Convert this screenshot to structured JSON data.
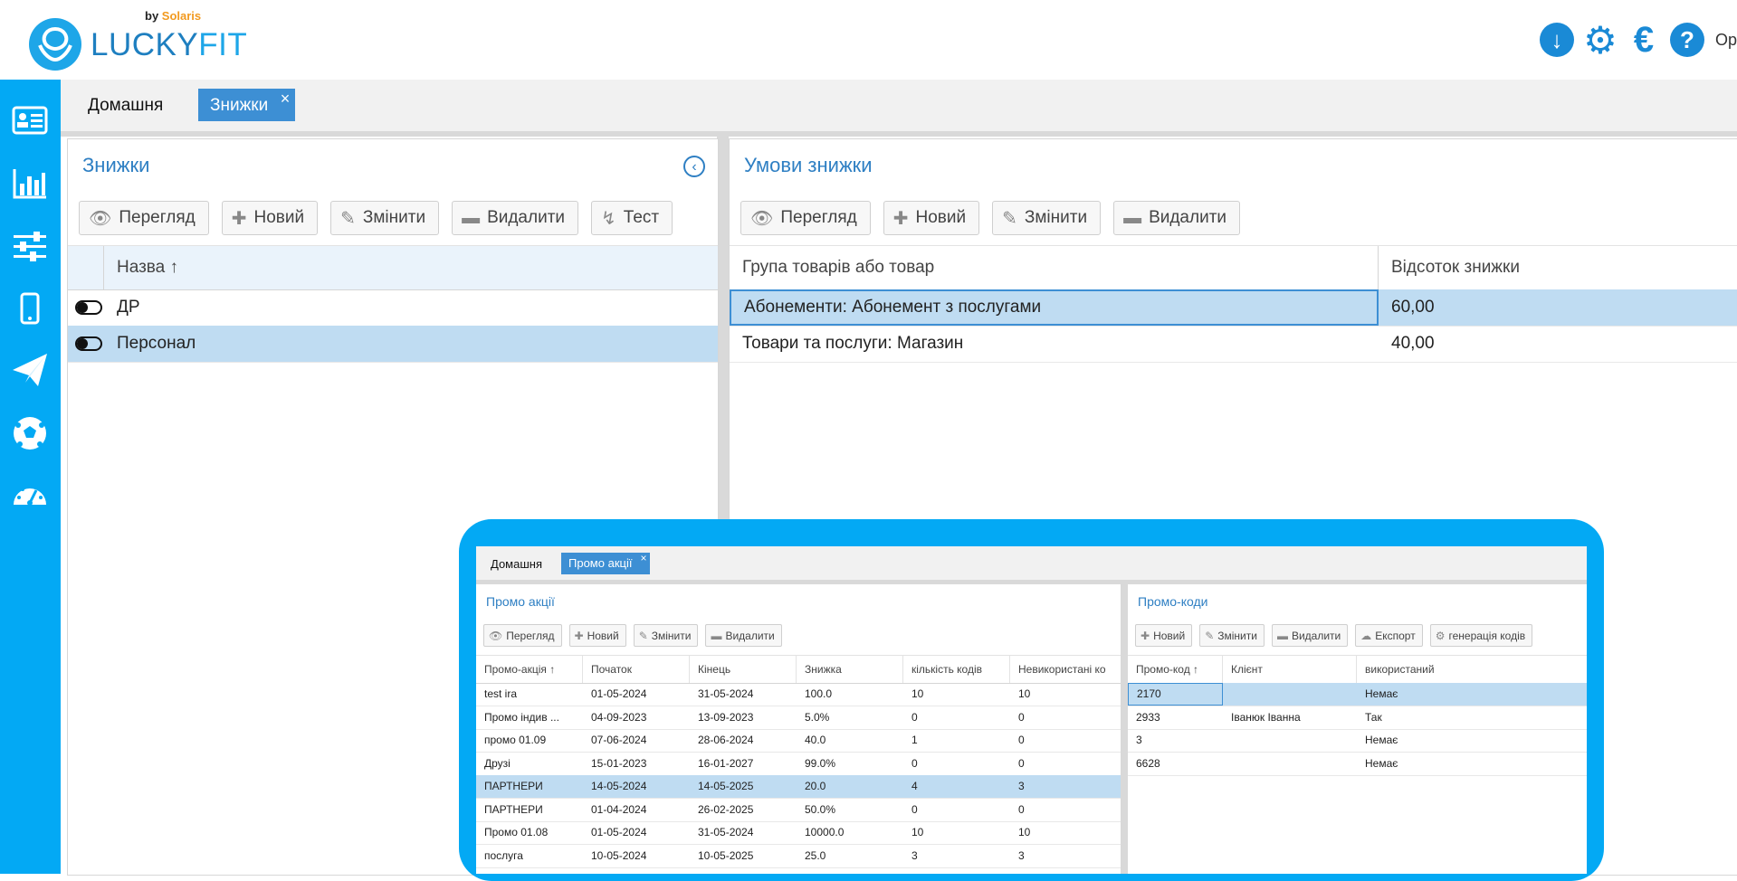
{
  "header": {
    "logo_by": "by",
    "logo_brand": "Solaris",
    "logo_lucky": "LUCKY",
    "logo_fit": "FIT",
    "user_text": "Op"
  },
  "colors": {
    "accent": "#03a9f4",
    "primary": "#3d8fd4",
    "selected_row": "#bfdcf2",
    "title": "#2e7fc3"
  },
  "sidebar": {
    "items": [
      {
        "icon": "contact-card-icon"
      },
      {
        "icon": "bar-chart-icon"
      },
      {
        "icon": "sliders-icon"
      },
      {
        "icon": "mobile-phone-icon"
      },
      {
        "icon": "paper-plane-icon"
      },
      {
        "icon": "soccer-ball-icon"
      },
      {
        "icon": "dashboard-gauge-icon"
      }
    ]
  },
  "tabs": {
    "home": "Домашня",
    "active": "Знижки",
    "close": "×"
  },
  "left_panel": {
    "title": "Знижки",
    "buttons": {
      "view": "Перегляд",
      "new": "Новий",
      "edit": "Змінити",
      "delete": "Видалити",
      "test": "Тест"
    },
    "column": "Назва ↑",
    "rows": [
      {
        "name": "ДР",
        "selected": false
      },
      {
        "name": "Персонал",
        "selected": true
      }
    ]
  },
  "right_panel": {
    "title": "Умови знижки",
    "buttons": {
      "view": "Перегляд",
      "new": "Новий",
      "edit": "Змінити",
      "delete": "Видалити"
    },
    "columns": [
      "Група товарів або товар",
      "Відсоток знижки"
    ],
    "rows": [
      [
        "Абонементи: Абонемент з послугами",
        "60,00"
      ],
      [
        "Товари та послуги: Магазин",
        "40,00"
      ]
    ]
  },
  "inset": {
    "tabs": {
      "home": "Домашня",
      "active": "Промо акції",
      "close": "×"
    },
    "promo": {
      "title": "Промо акції",
      "buttons": {
        "view": "Перегляд",
        "new": "Новий",
        "edit": "Змінити",
        "delete": "Видалити"
      },
      "columns": [
        "Промо-акція ↑",
        "Початок",
        "Кінець",
        "Знижка",
        "кількість кодів",
        "Невикористані ко"
      ],
      "rows": [
        [
          "test ira",
          "01-05-2024",
          "31-05-2024",
          "100.0",
          "10",
          "10"
        ],
        [
          "Промо індив ...",
          "04-09-2023",
          "13-09-2023",
          "5.0%",
          "0",
          "0"
        ],
        [
          "промо 01.09",
          "07-06-2024",
          "28-06-2024",
          "40.0",
          "1",
          "0"
        ],
        [
          "Друзі",
          "15-01-2023",
          "16-01-2027",
          "99.0%",
          "0",
          "0"
        ],
        [
          "ПАРТНЕРИ",
          "14-05-2024",
          "14-05-2025",
          "20.0",
          "4",
          "3"
        ],
        [
          "ПАРТНЕРИ",
          "01-04-2024",
          "26-02-2025",
          "50.0%",
          "0",
          "0"
        ],
        [
          "Промо 01.08",
          "01-05-2024",
          "31-05-2024",
          "10000.0",
          "10",
          "10"
        ],
        [
          "послуга",
          "10-05-2024",
          "10-05-2025",
          "25.0",
          "3",
          "3"
        ]
      ],
      "selected_index": 4
    },
    "codes": {
      "title": "Промо-коди",
      "buttons": {
        "new": "Новий",
        "edit": "Змінити",
        "delete": "Видалити",
        "export": "Експорт",
        "generate": "генерація кодів"
      },
      "columns": [
        "Промо-код ↑",
        "Клієнт",
        "використаний"
      ],
      "rows": [
        [
          "2170",
          "",
          "Немає"
        ],
        [
          "2933",
          "Іванюк Іванна",
          "Так"
        ],
        [
          "3",
          "",
          "Немає"
        ],
        [
          "6628",
          "",
          "Немає"
        ]
      ],
      "selected_index": 0
    }
  }
}
